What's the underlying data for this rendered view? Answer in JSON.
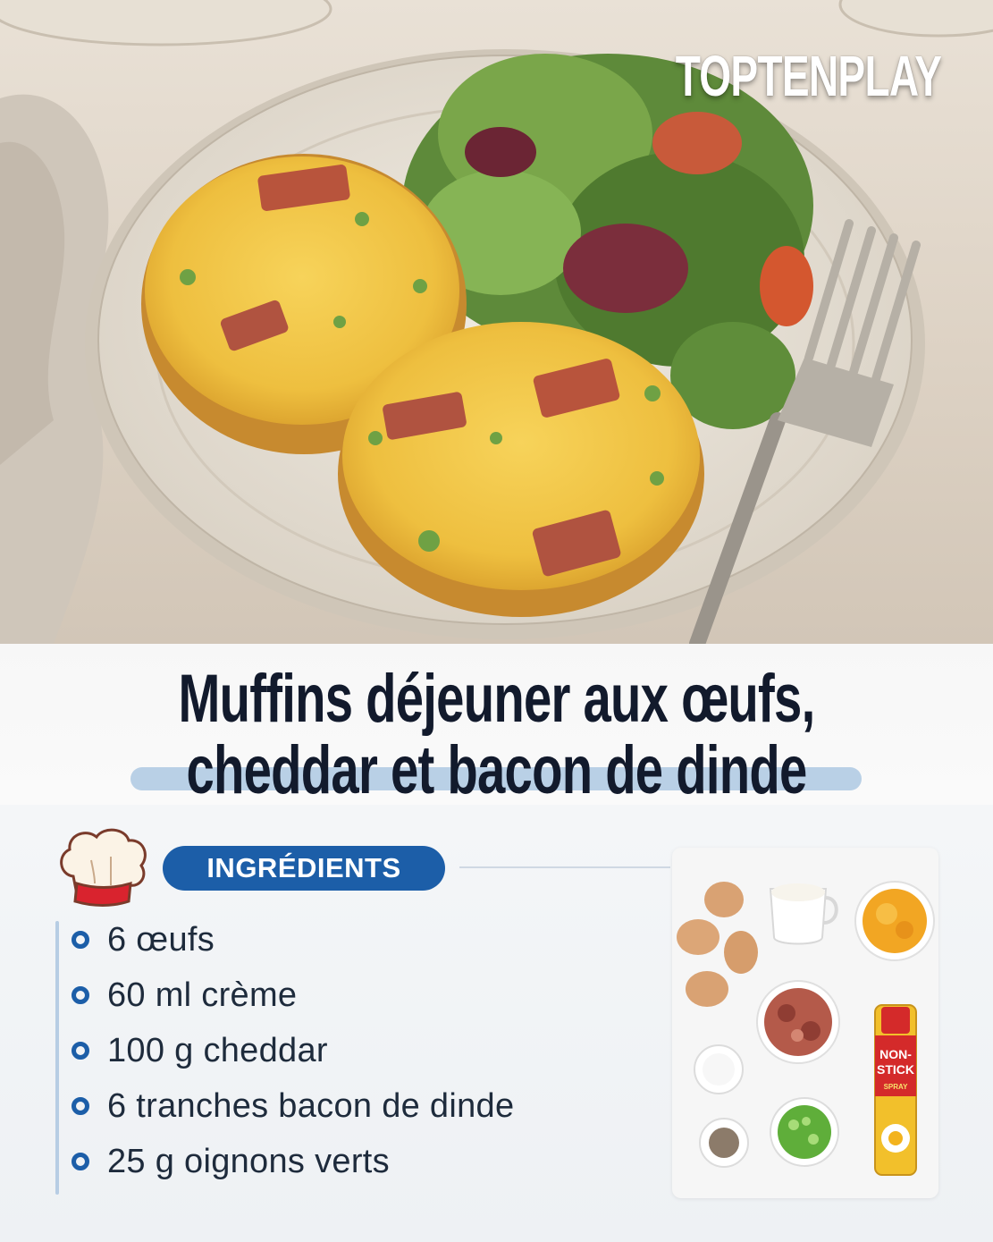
{
  "brand": {
    "name": "TOPTENPLAY"
  },
  "recipe": {
    "title_line1": "Muffins déjeuner aux œufs,",
    "title_line2": "cheddar et bacon de dinde"
  },
  "ingredients": {
    "header": "INGRÉDIENTS",
    "items": [
      "6 œufs",
      "60 ml crème",
      "100 g cheddar",
      "6 tranches bacon de dinde",
      "25 g oignons verts"
    ]
  },
  "spray_can": {
    "line1": "NON-",
    "line2": "STICK",
    "line3": "SPRAY"
  },
  "colors": {
    "accent_blue": "#1c5ea8",
    "title_navy": "#121a2c",
    "underline": "#b9d0e6"
  }
}
